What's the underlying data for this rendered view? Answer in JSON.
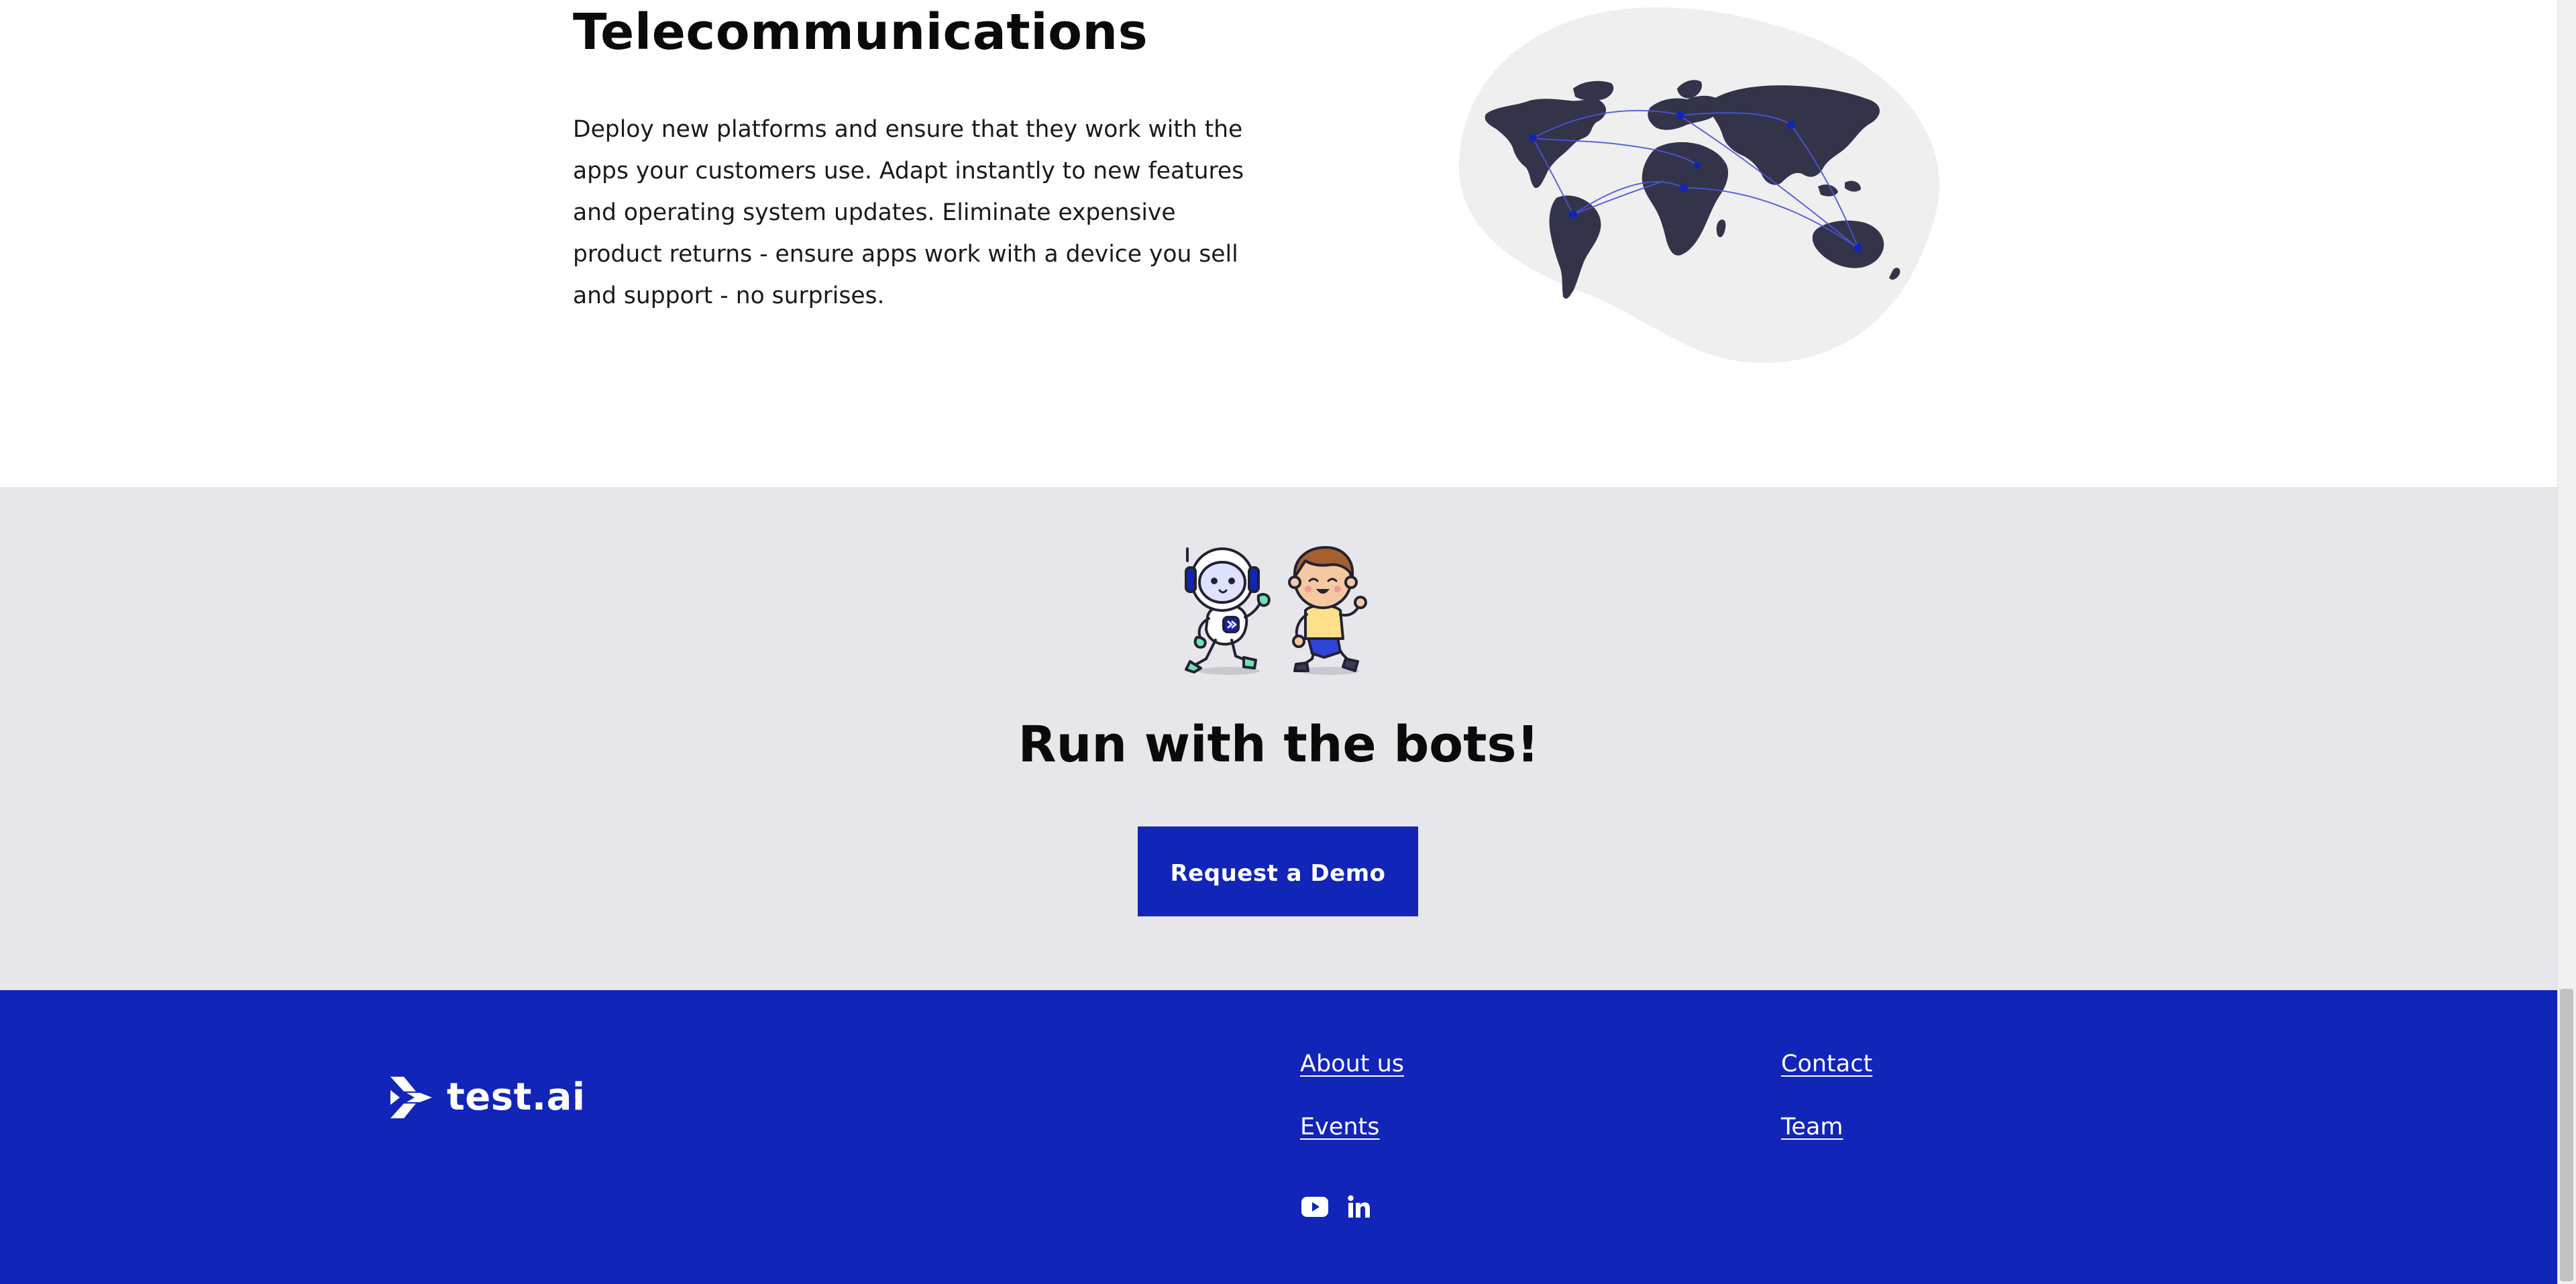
{
  "telecom": {
    "title": "Telecommunications",
    "body": "Deploy new platforms and ensure that they work with the apps your customers use. Adapt instantly to new features and operating system updates. Eliminate expensive product returns - ensure apps work with a device you sell and support - no surprises.",
    "illustration": "world-map-illustration"
  },
  "cta": {
    "illustration": "robot-and-boy-running-illustration",
    "title": "Run with the bots!",
    "button_label": "Request a Demo"
  },
  "footer": {
    "logo_text": "test.ai",
    "links": {
      "about": "About us",
      "events": "Events",
      "contact": "Contact",
      "team": "Team"
    },
    "social": [
      "youtube-icon",
      "linkedin-icon"
    ]
  },
  "colors": {
    "brand_blue": "#1125b8",
    "cta_background": "#e6e6eb",
    "map_land": "#33334a",
    "map_blob": "#efefef",
    "text_dark": "#0a0a0a"
  }
}
